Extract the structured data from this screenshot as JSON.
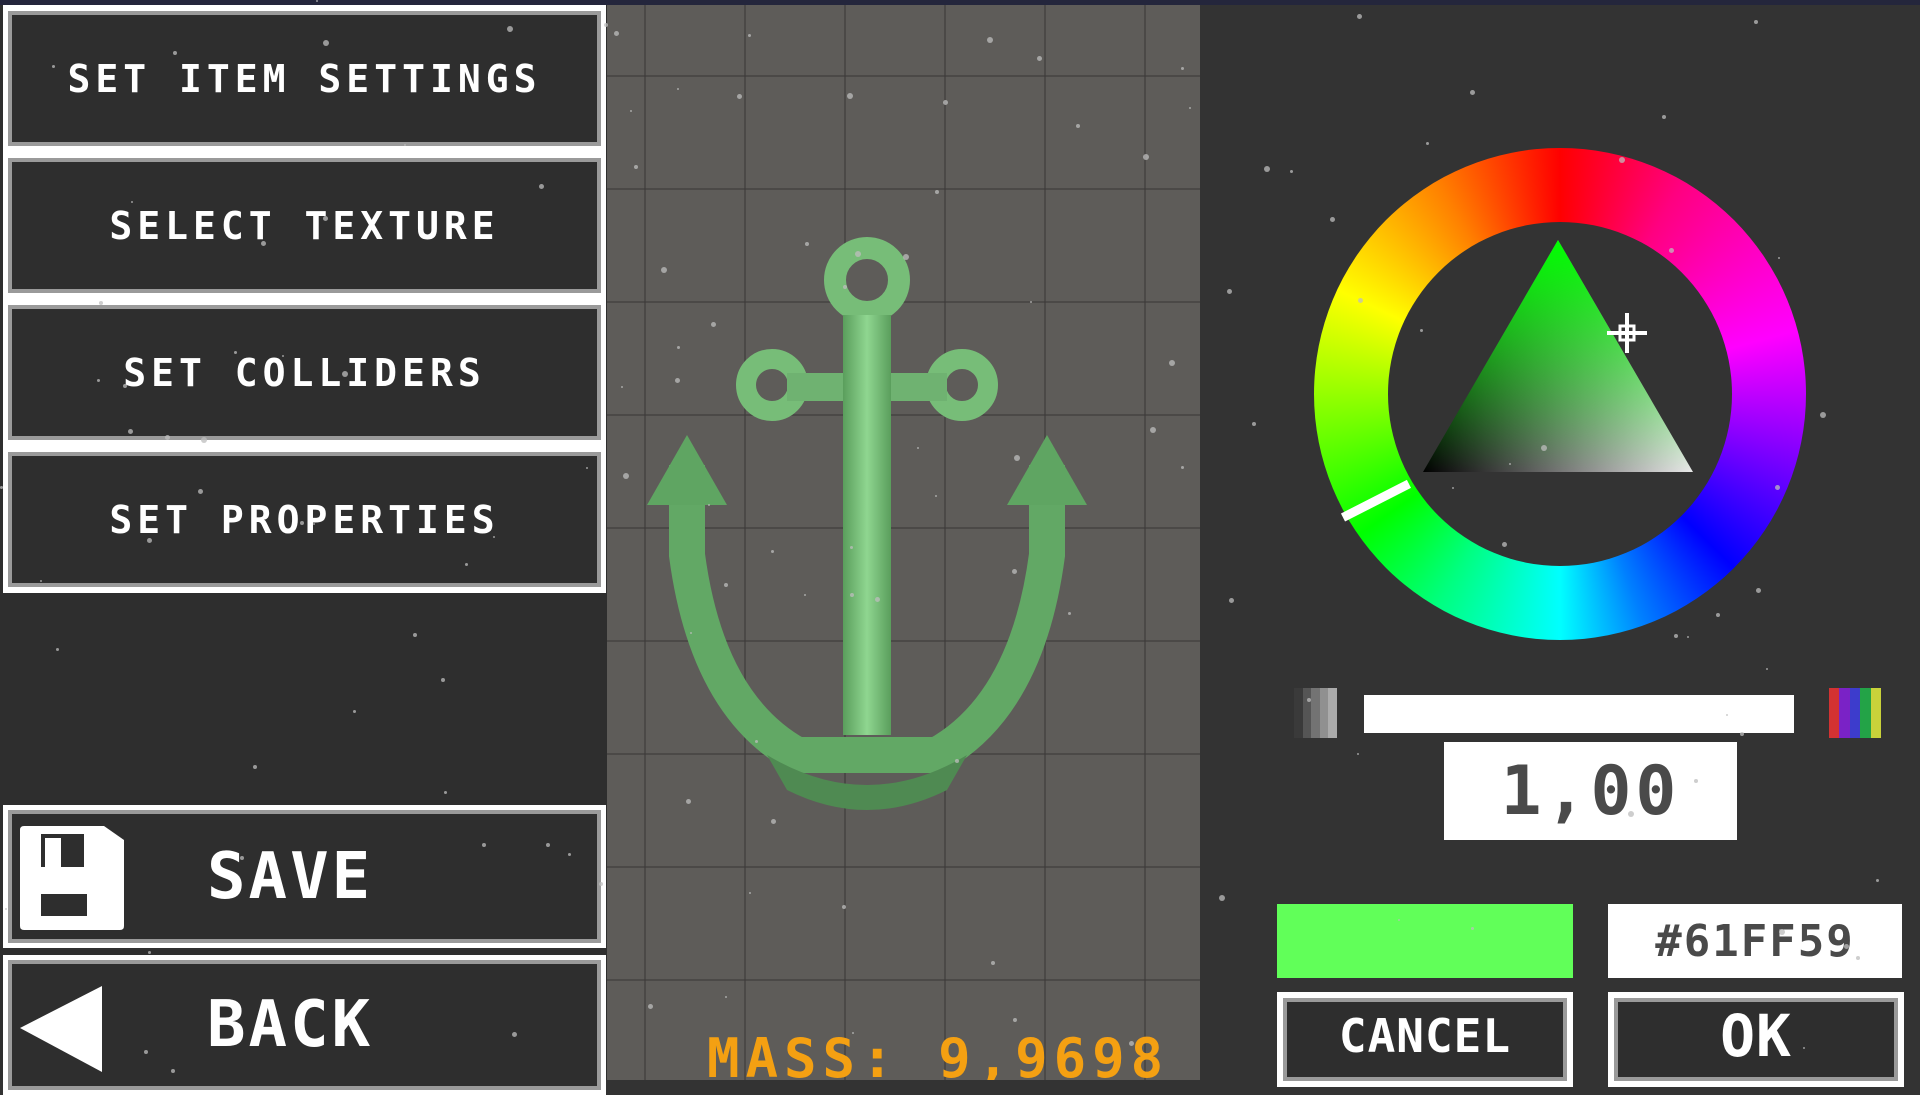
{
  "menu": {
    "items": [
      {
        "label": "SET ITEM SETTINGS"
      },
      {
        "label": "SELECT TEXTURE"
      },
      {
        "label": "SET COLLIDERS"
      },
      {
        "label": "SET PROPERTIES"
      }
    ],
    "save": {
      "label": "SAVE",
      "icon": "floppy-disk-icon"
    },
    "back": {
      "label": "BACK",
      "icon": "back-arrow-icon"
    }
  },
  "canvas": {
    "item": "anchor",
    "mass_text": "MASS: 9,9698",
    "item_color": "#61FF59"
  },
  "color_picker": {
    "hue_degrees": 118,
    "brightness_slider": 1.0,
    "value_text": "1,00",
    "preview_color": "#61FF59",
    "hex_value": "#61FF59",
    "cancel_label": "CANCEL",
    "ok_label": "OK",
    "icons": {
      "grayscale": "grayscale-swatch-icon",
      "rainbow": "rainbow-swatch-icon"
    }
  },
  "colors": {
    "mass_text": "#F4A012",
    "panel_bg": "#333333",
    "canvas_bg": "#5E5C59"
  }
}
